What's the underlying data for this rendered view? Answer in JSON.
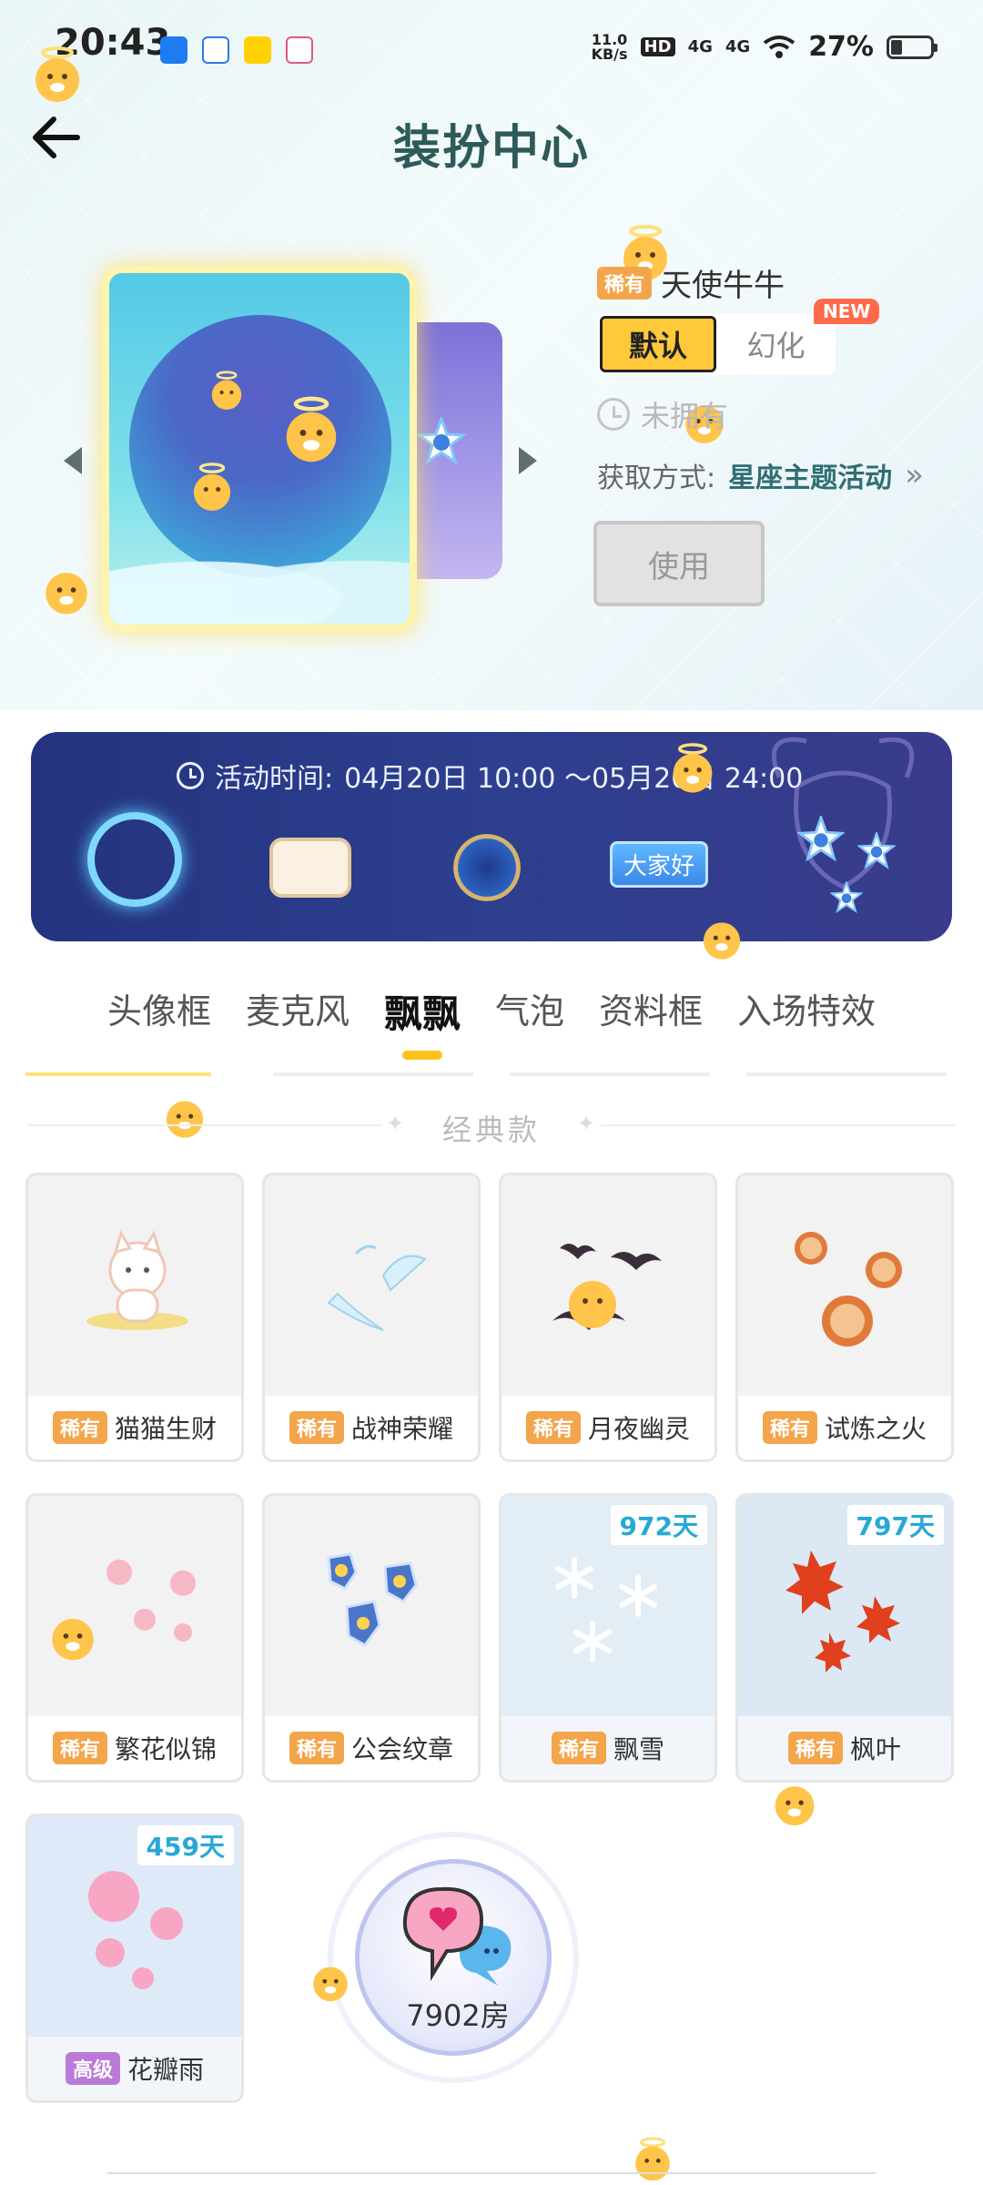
{
  "status_bar": {
    "time": "20:43",
    "net_speed_value": "11.0",
    "net_speed_unit": "KB/s",
    "hd_badge": "HD",
    "sim1_tag": "4G",
    "sim2_tag": "4G",
    "battery_percent": "27%"
  },
  "header": {
    "title": "装扮中心",
    "back_icon": "back-arrow-icon"
  },
  "preview": {
    "rarity": "稀有",
    "item_name": "天使牛牛",
    "variant_default": "默认",
    "variant_alt": "幻化",
    "new_badge": "NEW",
    "status_text": "未拥有",
    "acquire_label": "获取方式:",
    "acquire_value": "星座主题活动",
    "acquire_chevron": "»",
    "use_button": "使用"
  },
  "banner": {
    "time_label": "活动时间:",
    "time_range": "04月20日 10:00 ～05月20日 24:00",
    "bubble_text": "大家好"
  },
  "category_tabs": [
    {
      "label": "头像框",
      "active": false
    },
    {
      "label": "麦克风",
      "active": false
    },
    {
      "label": "飘飘",
      "active": true
    },
    {
      "label": "气泡",
      "active": false
    },
    {
      "label": "资料框",
      "active": false
    },
    {
      "label": "入场特效",
      "active": false
    }
  ],
  "section_title": "经典款",
  "items": [
    {
      "tag": "稀有",
      "name": "猫猫生财",
      "days": null
    },
    {
      "tag": "稀有",
      "name": "战神荣耀",
      "days": null
    },
    {
      "tag": "稀有",
      "name": "月夜幽灵",
      "days": null
    },
    {
      "tag": "稀有",
      "name": "试炼之火",
      "days": null
    },
    {
      "tag": "稀有",
      "name": "繁花似锦",
      "days": null
    },
    {
      "tag": "稀有",
      "name": "公会纹章",
      "days": null
    },
    {
      "tag": "稀有",
      "name": "飘雪",
      "days": "972天"
    },
    {
      "tag": "稀有",
      "name": "枫叶",
      "days": "797天"
    },
    {
      "tag": "高级",
      "name": "花瓣雨",
      "days": "459天"
    }
  ],
  "room_float": {
    "label": "7902房"
  },
  "colors": {
    "accent_yellow": "#ffc93a",
    "rarity_orange": "#f3a54b",
    "tag_purple": "#b97ad8",
    "title_teal": "#2e5a5a",
    "days_blue": "#27a8d6",
    "banner_navy": "#2d3f8e"
  }
}
